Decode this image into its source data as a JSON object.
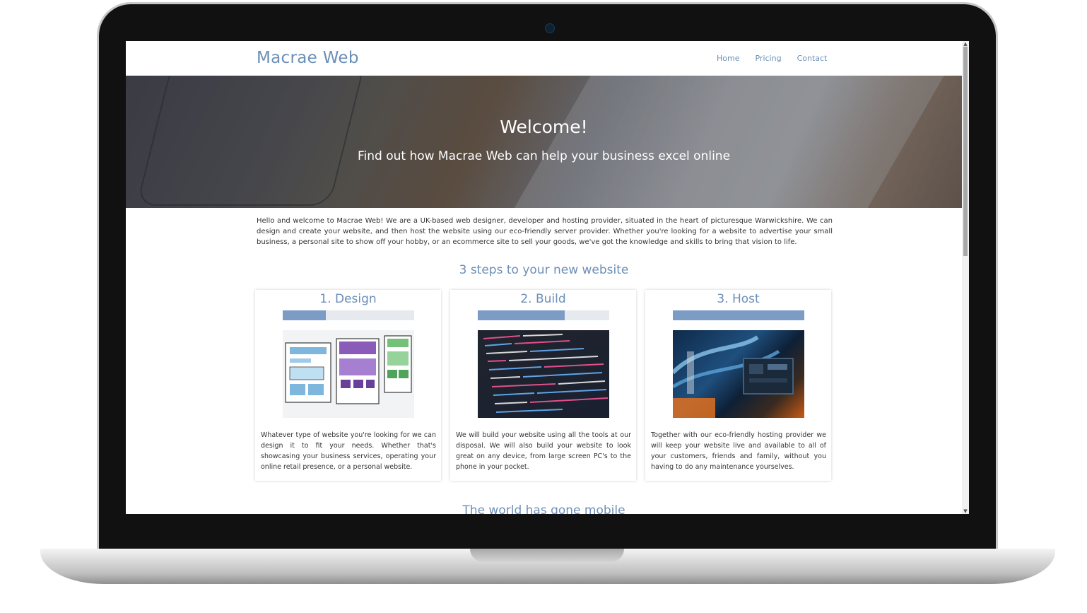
{
  "nav": {
    "brand": "Macrae Web",
    "links": [
      "Home",
      "Pricing",
      "Contact"
    ]
  },
  "hero": {
    "title": "Welcome!",
    "subtitle": "Find out how Macrae Web can help your business excel online"
  },
  "intro": "Hello and welcome to Macrae Web! We are a UK-based web designer, developer and hosting provider, situated in the heart of picturesque Warwickshire. We can design and create your website, and then host the website using our eco-friendly server provider. Whether you're looking for a website to advertise your small business, a personal site to show off your hobby, or an ecommerce site to sell your goods, we've got the knowledge and skills to bring that vision to life.",
  "steps": {
    "heading": "3 steps to your new website",
    "cards": [
      {
        "title": "1. Design",
        "progress": 0.33,
        "text": "Whatever type of website you're looking for we can design it to fit your needs. Whether that's showcasing your business services, operating your online retail presence, or a personal website."
      },
      {
        "title": "2. Build",
        "progress": 0.66,
        "text": "We will build your website using all the tools at our disposal. We will also build your website to look great on any device, from large screen PC's to the phone in your pocket."
      },
      {
        "title": "3. Host",
        "progress": 1.0,
        "text": "Together with our eco-friendly hosting provider we will keep your website live and available to all of your customers, friends and family, without you having to do any maintenance yourselves."
      }
    ]
  },
  "next_heading": "The world has gone mobile",
  "colors": {
    "accent": "#6b8fb8",
    "progress_fill": "#7c9cc6",
    "progress_track": "#e6e9ee"
  }
}
